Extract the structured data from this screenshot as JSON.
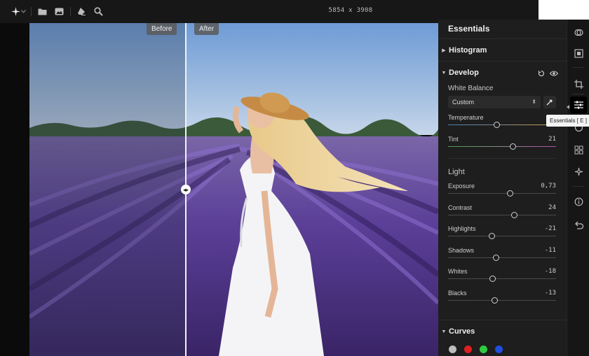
{
  "toolbar": {
    "icons": [
      "sparkle-icon",
      "chevron-down-icon",
      "folder-icon",
      "image-icon",
      "eraser-icon",
      "zoom-icon"
    ],
    "dimensions": "5854 x 3908"
  },
  "compare": {
    "before_label": "Before",
    "after_label": "After",
    "split_position": 0.38
  },
  "panel": {
    "title": "Essentials",
    "histogram_label": "Histogram",
    "develop_label": "Develop",
    "white_balance_label": "White Balance",
    "white_balance_value": "Custom",
    "temperature": {
      "label": "Temperature",
      "value": "",
      "position": 0.45
    },
    "tint": {
      "label": "Tint",
      "value": "21",
      "position": 0.6
    },
    "light_label": "Light",
    "light_sliders": [
      {
        "label": "Exposure",
        "value": "0,73",
        "position": 0.57
      },
      {
        "label": "Contrast",
        "value": "24",
        "position": 0.61
      },
      {
        "label": "Highlights",
        "value": "-21",
        "position": 0.4
      },
      {
        "label": "Shadows",
        "value": "-11",
        "position": 0.44
      },
      {
        "label": "Whites",
        "value": "-18",
        "position": 0.41
      },
      {
        "label": "Blacks",
        "value": "-13",
        "position": 0.43
      }
    ],
    "curves_label": "Curves",
    "curve_channels": [
      "#bdbdbd",
      "#e02020",
      "#2ecc40",
      "#1f4fe0"
    ]
  },
  "tooltip": {
    "text": "Essentials  [ E ]"
  },
  "rail": {
    "icons": [
      "layers-icon",
      "frame-icon",
      "crop-icon",
      "sliders-icon",
      "mask-icon",
      "grid-icon",
      "ai-sparkle-icon",
      "info-icon",
      "undo-icon"
    ]
  },
  "colors": {
    "panel_bg": "#1e1e1e",
    "toolbar_bg": "#171717",
    "accent": "#ffffff"
  }
}
